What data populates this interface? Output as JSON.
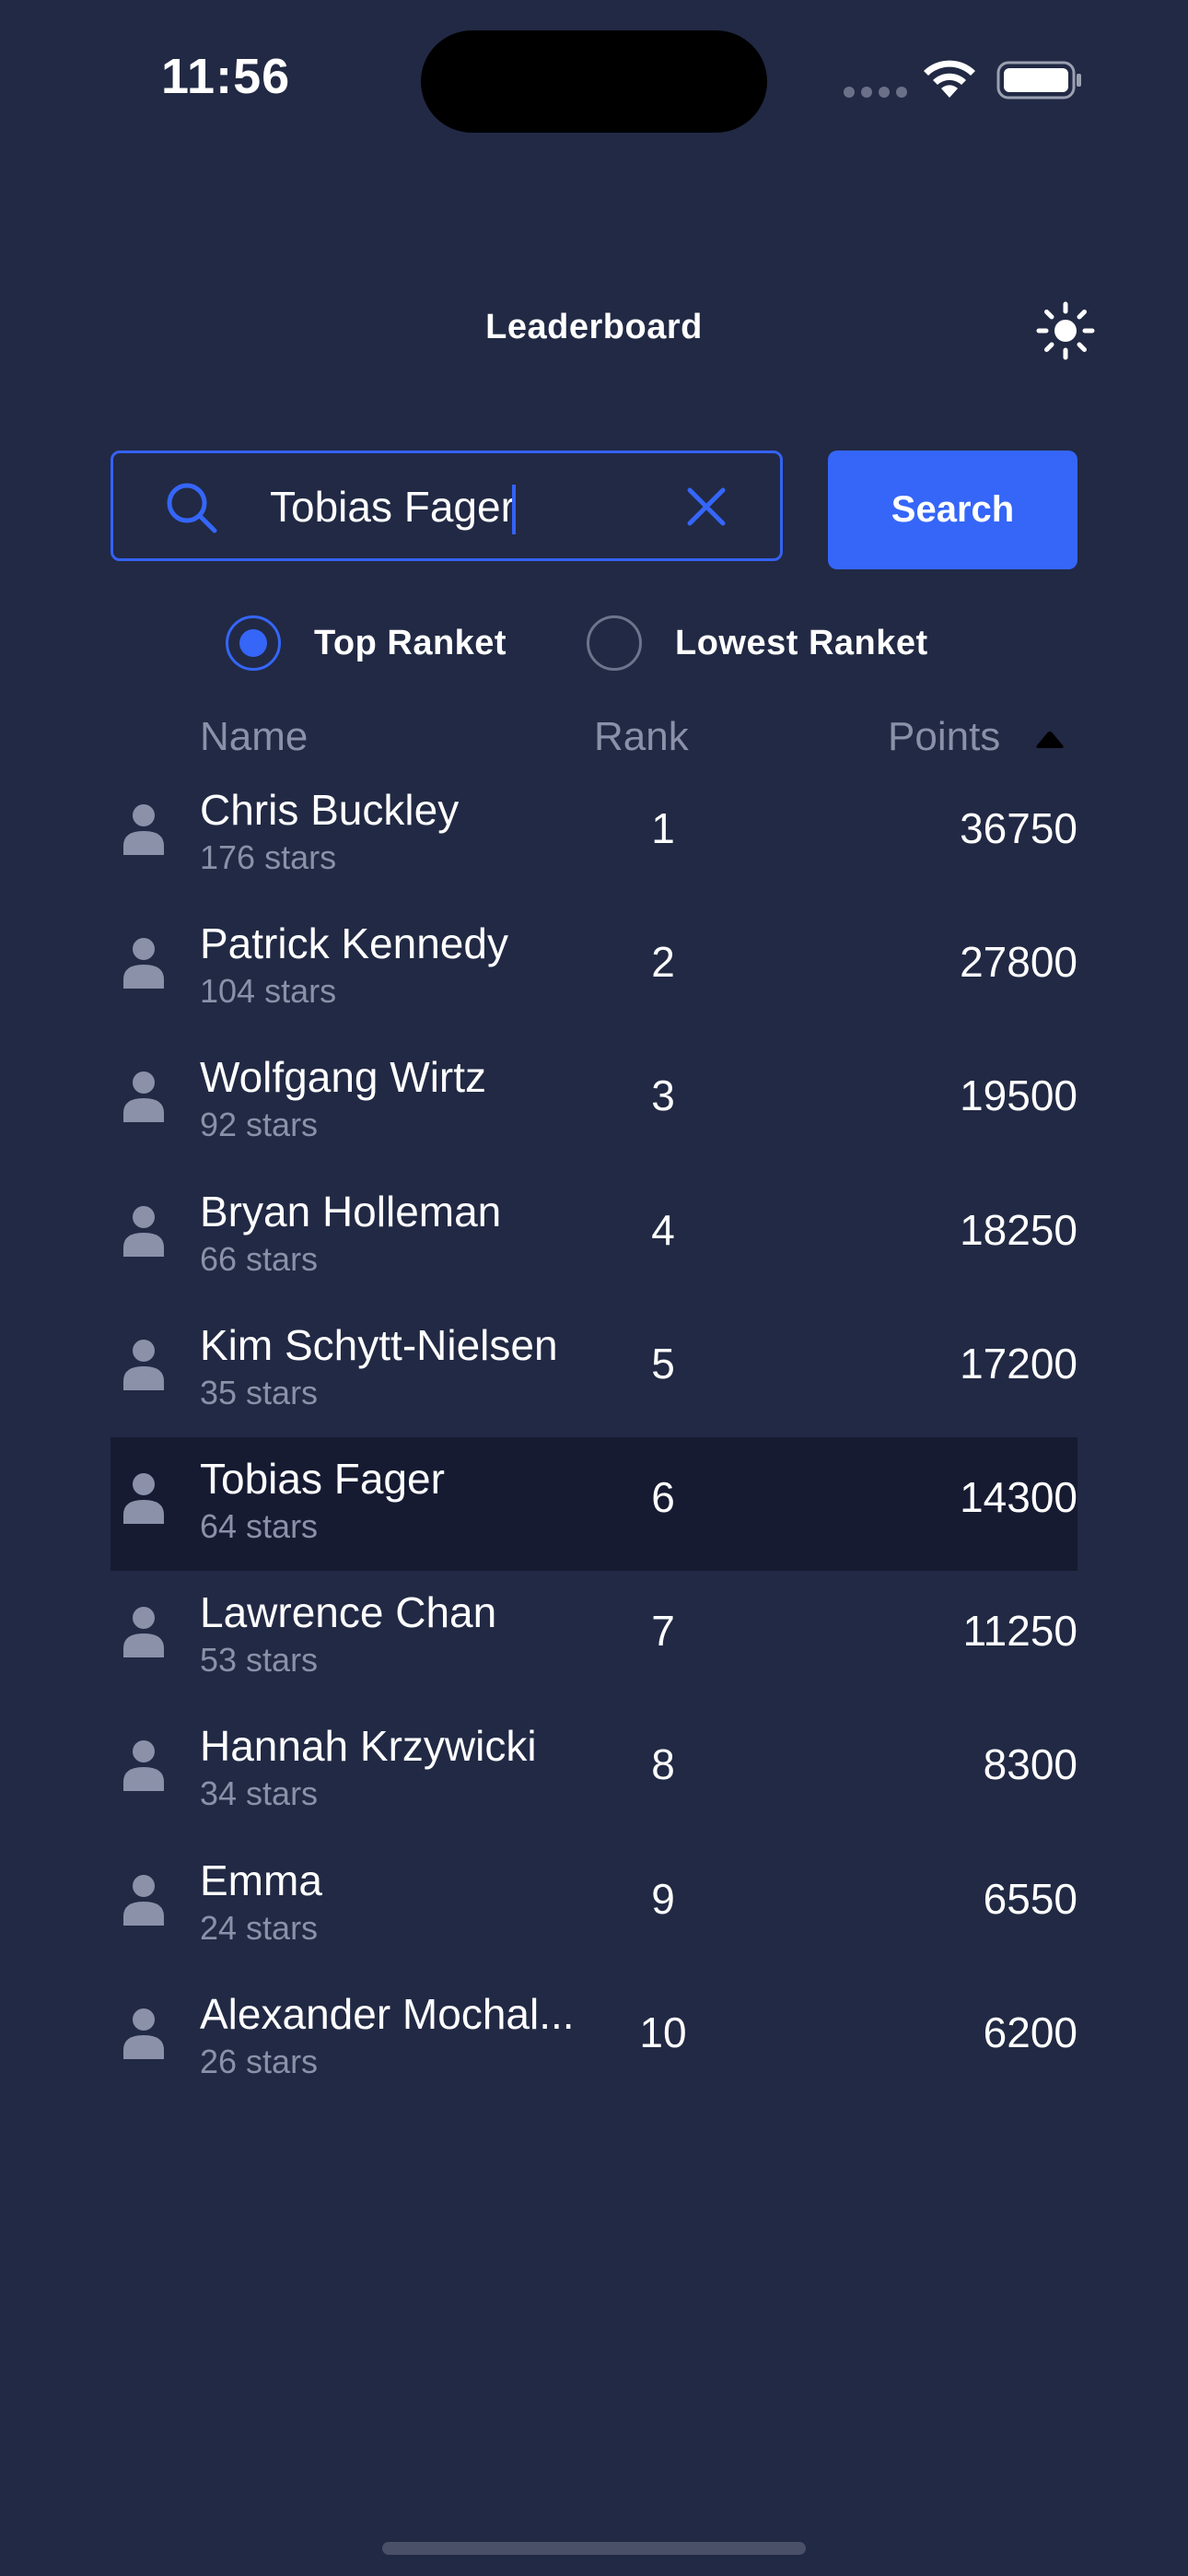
{
  "status_bar": {
    "time": "11:56"
  },
  "header": {
    "title": "Leaderboard",
    "theme_icon": "sun-icon"
  },
  "search": {
    "value": "Tobias Fager",
    "button_label": "Search"
  },
  "sort_options": [
    {
      "label": "Top Ranket",
      "selected": true
    },
    {
      "label": "Lowest Ranket",
      "selected": false
    }
  ],
  "table": {
    "columns": {
      "name": "Name",
      "rank": "Rank",
      "points": "Points"
    },
    "sort_direction_icon": "triangle-up-icon",
    "rows": [
      {
        "name": "Chris Buckley",
        "stars": "176 stars",
        "rank": "1",
        "points": "36750",
        "highlighted": false
      },
      {
        "name": "Patrick Kennedy",
        "stars": "104 stars",
        "rank": "2",
        "points": "27800",
        "highlighted": false
      },
      {
        "name": "Wolfgang Wirtz",
        "stars": "92 stars",
        "rank": "3",
        "points": "19500",
        "highlighted": false
      },
      {
        "name": "Bryan Holleman",
        "stars": "66 stars",
        "rank": "4",
        "points": "18250",
        "highlighted": false
      },
      {
        "name": "Kim Schytt-Nielsen",
        "stars": "35 stars",
        "rank": "5",
        "points": "17200",
        "highlighted": false
      },
      {
        "name": "Tobias Fager",
        "stars": "64 stars",
        "rank": "6",
        "points": "14300",
        "highlighted": true
      },
      {
        "name": "Lawrence Chan",
        "stars": "53 stars",
        "rank": "7",
        "points": "11250",
        "highlighted": false
      },
      {
        "name": "Hannah Krzywicki",
        "stars": "34 stars",
        "rank": "8",
        "points": "8300",
        "highlighted": false
      },
      {
        "name": "Emma",
        "stars": "24 stars",
        "rank": "9",
        "points": "6550",
        "highlighted": false
      },
      {
        "name": "Alexander Mochal...",
        "stars": "26 stars",
        "rank": "10",
        "points": "6200",
        "highlighted": false
      }
    ]
  },
  "colors": {
    "background": "#212944",
    "accent": "#3566f8",
    "highlight_row": "#161b32",
    "muted_text": "#8a91a8"
  }
}
